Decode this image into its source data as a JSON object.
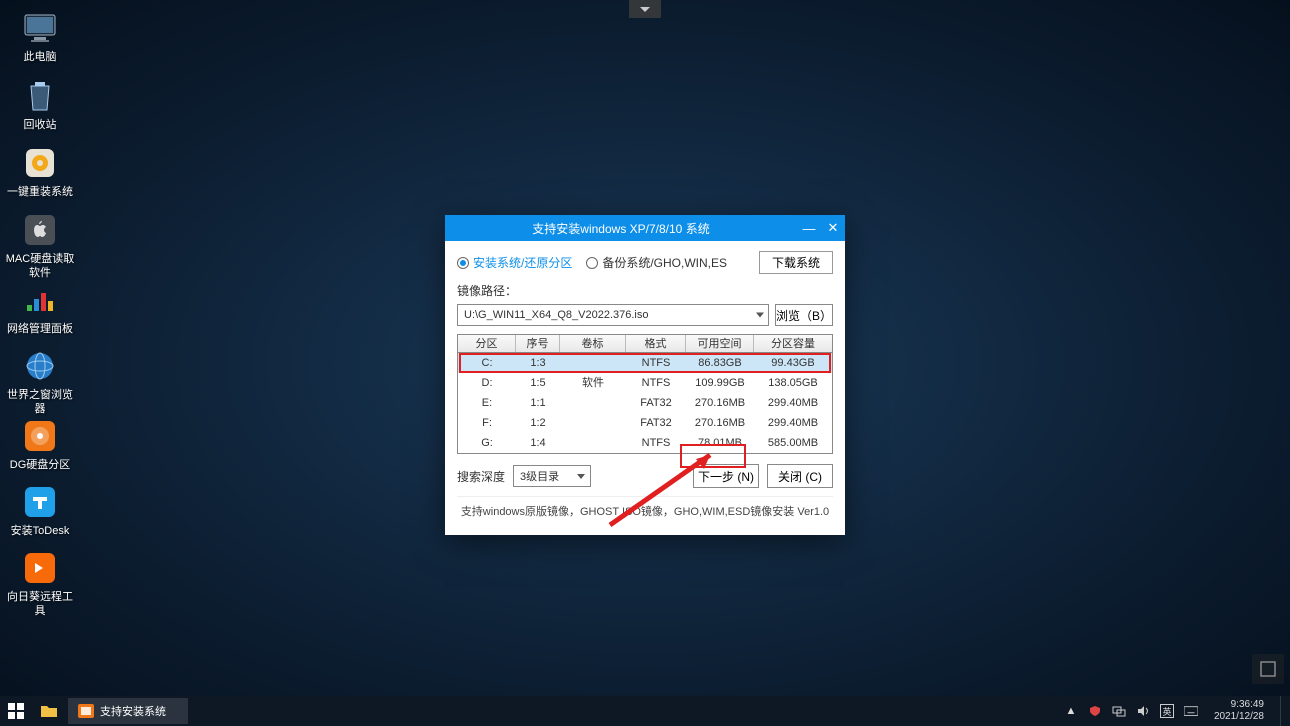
{
  "desktop": {
    "icons": [
      {
        "name": "此电脑"
      },
      {
        "name": "回收站"
      },
      {
        "name": "一键重装系统"
      },
      {
        "name": "MAC硬盘读取软件"
      },
      {
        "name": "网络管理面板"
      },
      {
        "name": "世界之窗浏览器"
      },
      {
        "name": "DG硬盘分区"
      },
      {
        "name": "安装ToDesk"
      },
      {
        "name": "向日葵远程工具"
      }
    ]
  },
  "dialog": {
    "title": "支持安装windows XP/7/8/10 系统",
    "radio1": "安装系统/还原分区",
    "radio2": "备份系统/GHO,WIN,ES",
    "download": "下载系统",
    "path_label": "镜像路径：",
    "path_value": "U:\\G_WIN11_X64_Q8_V2022.376.iso",
    "browse": "浏览（B）",
    "headers": {
      "c1": "分区",
      "c2": "序号",
      "c3": "卷标",
      "c4": "格式",
      "c5": "可用空间",
      "c6": "分区容量"
    },
    "rows": [
      {
        "c1": "C:",
        "c2": "1:3",
        "c3": "",
        "c4": "NTFS",
        "c5": "86.83GB",
        "c6": "99.43GB"
      },
      {
        "c1": "D:",
        "c2": "1:5",
        "c3": "软件",
        "c4": "NTFS",
        "c5": "109.99GB",
        "c6": "138.05GB"
      },
      {
        "c1": "E:",
        "c2": "1:1",
        "c3": "",
        "c4": "FAT32",
        "c5": "270.16MB",
        "c6": "299.40MB"
      },
      {
        "c1": "F:",
        "c2": "1:2",
        "c3": "",
        "c4": "FAT32",
        "c5": "270.16MB",
        "c6": "299.40MB"
      },
      {
        "c1": "G:",
        "c2": "1:4",
        "c3": "",
        "c4": "NTFS",
        "c5": "78.01MB",
        "c6": "585.00MB"
      }
    ],
    "depth_label": "搜索深度",
    "depth_value": "3级目录",
    "next": "下一步 (N)",
    "close": "关闭 (C)",
    "footer": "支持windows原版镜像，GHOST ISO镜像，GHO,WIM,ESD镜像安装 Ver1.0"
  },
  "taskbar": {
    "app": "支持安装系统",
    "time": "9:36:49",
    "date": "2021/12/28"
  }
}
